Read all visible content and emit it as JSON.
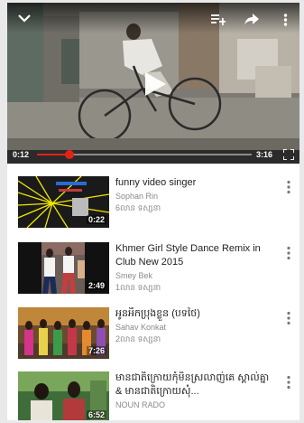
{
  "player": {
    "current_time": "0:12",
    "duration": "3:16",
    "progress": 0.15,
    "icons": {
      "minimize": "chevron-down-icon",
      "add_to_playlist": "playlist-add-icon",
      "share": "share-icon",
      "menu": "more-vert-icon",
      "play": "play-icon",
      "fullscreen": "fullscreen-icon"
    }
  },
  "videos": [
    {
      "title": "funny video singer",
      "channel": "Sophan Rin",
      "views": "6លាន ទស្សនា",
      "duration": "0:22"
    },
    {
      "title": "Khmer Girl Style Dance Remix in Club New 2015",
      "channel": "Smey Bek",
      "views": "1លាន ទស្សនា",
      "duration": "2:49"
    },
    {
      "title": "អូនអឹកប្រុងខ្លួន (បទថៃ)",
      "channel": "Sahav Konkat",
      "views": "2លាន ទស្សនា",
      "duration": "7:26"
    },
    {
      "title": "មានជាតិក្រោយកុំមិនស្រលាញ់គេ ស្គាល់គ្នា & មានជាតិក្រោយសុំ...",
      "channel": "NOUN RADO",
      "views": "",
      "duration": "6:52"
    }
  ],
  "colors": {
    "accent": "#e62117",
    "title_text": "#222222",
    "meta_text": "#8a8a8a"
  }
}
